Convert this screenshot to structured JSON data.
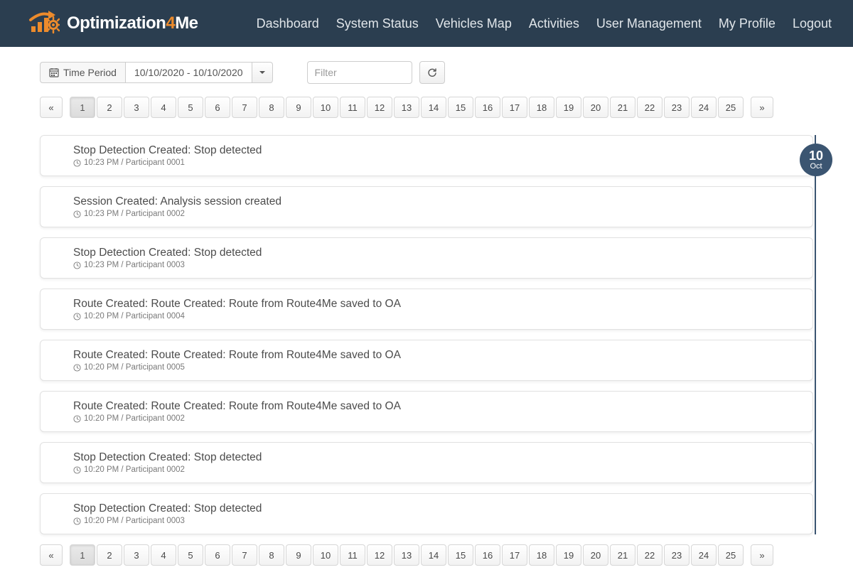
{
  "brand": {
    "name_left": "Optimization",
    "name_mid": "4",
    "name_right": "Me"
  },
  "nav": [
    "Dashboard",
    "System Status",
    "Vehicles Map",
    "Activities",
    "User Management",
    "My Profile",
    "Logout"
  ],
  "toolbar": {
    "time_label": "Time Period",
    "date_range": "10/10/2020 - 10/10/2020",
    "filter_placeholder": "Filter"
  },
  "pagination": {
    "prev": "«",
    "next": "»",
    "active": "1",
    "pages": [
      "1",
      "2",
      "3",
      "4",
      "5",
      "6",
      "7",
      "8",
      "9",
      "10",
      "11",
      "12",
      "13",
      "14",
      "15",
      "16",
      "17",
      "18",
      "19",
      "20",
      "21",
      "22",
      "23",
      "24",
      "25"
    ]
  },
  "date_badge": {
    "day": "10",
    "month": "Oct"
  },
  "activities": [
    {
      "title": "Stop Detection Created: Stop detected",
      "time": "10:23 PM",
      "actor": "Participant 0001"
    },
    {
      "title": "Session Created: Analysis session created",
      "time": "10:23 PM",
      "actor": "Participant 0002"
    },
    {
      "title": "Stop Detection Created: Stop detected",
      "time": "10:23 PM",
      "actor": "Participant 0003"
    },
    {
      "title": "Route Created: Route Created: Route from Route4Me saved to OA",
      "time": "10:20 PM",
      "actor": "Participant 0004"
    },
    {
      "title": "Route Created: Route Created: Route from Route4Me saved to OA",
      "time": "10:20 PM",
      "actor": "Participant 0005"
    },
    {
      "title": "Route Created: Route Created: Route from Route4Me saved to OA",
      "time": "10:20 PM",
      "actor": "Participant 0002"
    },
    {
      "title": "Stop Detection Created: Stop detected",
      "time": "10:20 PM",
      "actor": "Participant 0002"
    },
    {
      "title": "Stop Detection Created: Stop detected",
      "time": "10:20 PM",
      "actor": "Participant 0003"
    }
  ]
}
